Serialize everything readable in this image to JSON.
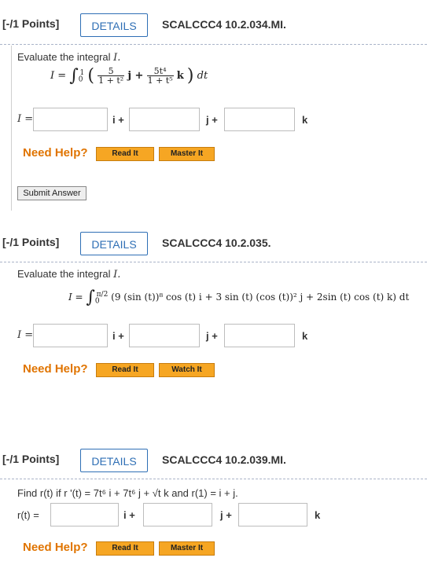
{
  "q1": {
    "points": "[-/1 Points]",
    "details_label": "DETAILS",
    "code": "SCALCCC4 10.2.034.MI.",
    "prompt_prefix": "Evaluate the integral",
    "prompt_var": "I.",
    "formula": {
      "lhs": "I =",
      "lower": "0",
      "upper": "1",
      "num1": "5",
      "den1": "1 + t²",
      "vec1": "j +",
      "num2": "5t⁴",
      "den2": "1 + t⁵",
      "vec2": "k",
      "dt": "dt"
    },
    "answer_label": "I =",
    "units": [
      "i +",
      "j +",
      "k"
    ],
    "need_help": "Need Help?",
    "buttons": [
      "Read It",
      "Master It"
    ],
    "submit_label": "Submit Answer"
  },
  "q2": {
    "points": "[-/1 Points]",
    "details_label": "DETAILS",
    "code": "SCALCCC4 10.2.035.",
    "prompt_prefix": "Evaluate the integral",
    "prompt_var": "I.",
    "formula": {
      "lhs": "I =",
      "lower": "0",
      "upper": "π/2",
      "body": "(9 (sin (t))⁸ cos (t) i + 3 sin (t) (cos (t))² j + 2sin (t) cos (t) k) dt"
    },
    "answer_label": "I =",
    "units": [
      "i +",
      "j +",
      "k"
    ],
    "need_help": "Need Help?",
    "buttons": [
      "Read It",
      "Watch It"
    ]
  },
  "q3": {
    "points": "[-/1 Points]",
    "details_label": "DETAILS",
    "code": "SCALCCC4 10.2.039.MI.",
    "prompt": "Find r(t) if r '(t) = 7t⁶ i + 7t⁶ j + √t k and r(1) = i + j.",
    "answer_label": "r(t) =",
    "units": [
      "i +",
      "j +",
      "k"
    ],
    "need_help": "Need Help?",
    "buttons": [
      "Read It",
      "Master It"
    ]
  },
  "colors": {
    "details_border": "#2f6fb5",
    "need_help": "#e07400",
    "help_button": "#f6a623"
  }
}
